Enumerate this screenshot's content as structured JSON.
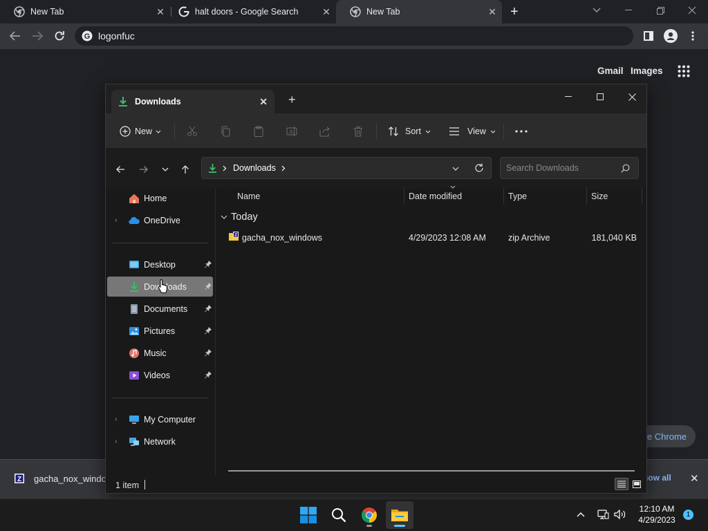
{
  "browser": {
    "tabs": [
      {
        "title": "New Tab",
        "active": false
      },
      {
        "title": "halt doors - Google Search",
        "active": false
      },
      {
        "title": "New Tab",
        "active": true
      }
    ],
    "new_tab_symbol": "+",
    "omnibox_text": "logonfuc"
  },
  "ntp": {
    "gmail": "Gmail",
    "images": "Images",
    "customize_label": "e Chrome"
  },
  "download_shelf": {
    "item_name": "gacha_nox_windo",
    "show_all": "how all"
  },
  "explorer": {
    "tab_title": "Downloads",
    "commands": {
      "new": "New",
      "sort": "Sort",
      "view": "View"
    },
    "address": {
      "location": "Downloads",
      "search_placeholder": "Search Downloads"
    },
    "nav": {
      "top": [
        {
          "label": "Home",
          "icon": "home-icon"
        },
        {
          "label": "OneDrive",
          "icon": "cloud-icon"
        }
      ],
      "quick_access": [
        {
          "label": "Desktop",
          "icon": "desktop-folder-icon",
          "pinned": true
        },
        {
          "label": "Downloads",
          "icon": "download-folder-icon",
          "pinned": true,
          "selected": true
        },
        {
          "label": "Documents",
          "icon": "documents-folder-icon",
          "pinned": true
        },
        {
          "label": "Pictures",
          "icon": "pictures-folder-icon",
          "pinned": true
        },
        {
          "label": "Music",
          "icon": "music-folder-icon",
          "pinned": true
        },
        {
          "label": "Videos",
          "icon": "videos-folder-icon",
          "pinned": true
        }
      ],
      "bottom": [
        {
          "label": "My Computer",
          "icon": "computer-icon"
        },
        {
          "label": "Network",
          "icon": "network-icon"
        }
      ]
    },
    "columns": [
      "Name",
      "Date modified",
      "Type",
      "Size"
    ],
    "group_label": "Today",
    "files": [
      {
        "name": "gacha_nox_windows",
        "date": "4/29/2023 12:08 AM",
        "type": "zip Archive",
        "size": "181,040 KB"
      }
    ],
    "status": "1 item"
  },
  "taskbar": {
    "time": "12:10 AM",
    "date": "4/29/2023",
    "notifications": "1"
  },
  "colors": {
    "accent": "#8ab4f8",
    "download_green": "#3fb86c",
    "selected_nav": "#777777"
  }
}
